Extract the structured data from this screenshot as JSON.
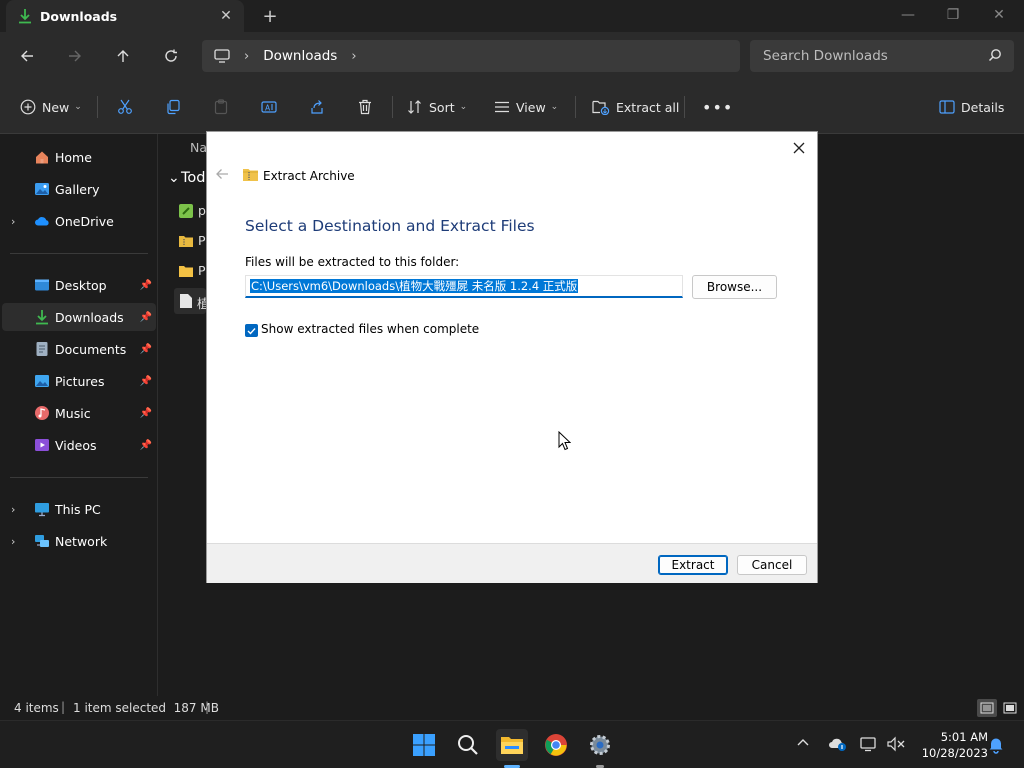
{
  "window": {
    "tab_title": "Downloads",
    "controls": [
      "minimize",
      "maximize",
      "close"
    ]
  },
  "nav": {
    "breadcrumb": "Downloads",
    "search_placeholder": "Search Downloads"
  },
  "commands": {
    "new": "New",
    "sort": "Sort",
    "view": "View",
    "extract_all": "Extract all",
    "details": "Details"
  },
  "sidebar": {
    "items": [
      {
        "label": "Home",
        "icon": "home-icon"
      },
      {
        "label": "Gallery",
        "icon": "gallery-icon"
      },
      {
        "label": "OneDrive",
        "icon": "cloud-icon"
      },
      {
        "label": "Desktop",
        "icon": "desktop-icon"
      },
      {
        "label": "Downloads",
        "icon": "download-icon"
      },
      {
        "label": "Documents",
        "icon": "documents-icon"
      },
      {
        "label": "Pictures",
        "icon": "pictures-icon"
      },
      {
        "label": "Music",
        "icon": "music-icon"
      },
      {
        "label": "Videos",
        "icon": "videos-icon"
      },
      {
        "label": "This PC",
        "icon": "pc-icon"
      },
      {
        "label": "Network",
        "icon": "network-icon"
      }
    ]
  },
  "filelist": {
    "header_name": "Na",
    "group": "Tod",
    "rows": [
      "p",
      "P",
      "P",
      "植"
    ]
  },
  "status": {
    "items": "4 items",
    "selected": "1 item selected  187 MB"
  },
  "dialog": {
    "title": "Extract Archive",
    "heading": "Select a Destination and Extract Files",
    "label": "Files will be extracted to this folder:",
    "path": "C:\\Users\\vm6\\Downloads\\植物大戰殭屍 未名版 1.2.4 正式版",
    "browse": "Browse...",
    "checkbox_label": "Show extracted files when complete",
    "checkbox_checked": true,
    "extract": "Extract",
    "cancel": "Cancel"
  },
  "tray": {
    "time": "5:01 AM",
    "date": "10/28/2023"
  },
  "colors": {
    "accent": "#0067c0",
    "dialog_heading": "#1e3c78",
    "selection": "#0078d7"
  }
}
